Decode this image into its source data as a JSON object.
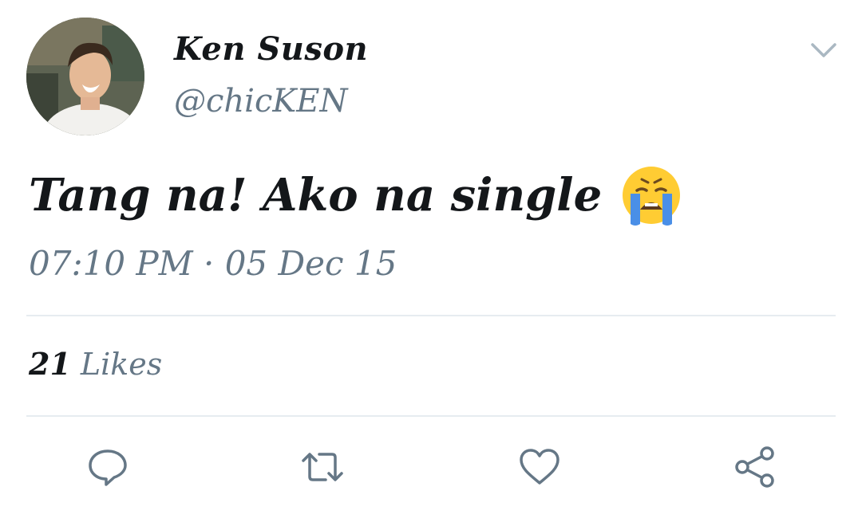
{
  "tweet": {
    "display_name": "Ken Suson",
    "handle": "@chicKEN",
    "text": "Tang na! Ako na single",
    "emoji": "loudly-crying-face-emoji",
    "timestamp": "07:10 PM · 05 Dec 15"
  },
  "stats": {
    "likes_count": "21",
    "likes_label": "Likes"
  },
  "actions": {
    "reply_icon": "speech-bubble-icon",
    "retweet_icon": "retweet-icon",
    "like_icon": "heart-icon",
    "share_icon": "share-icon"
  },
  "colors": {
    "text_primary": "#14171a",
    "text_secondary": "#657786",
    "divider": "#e6ecf0",
    "icon": "#657786"
  }
}
